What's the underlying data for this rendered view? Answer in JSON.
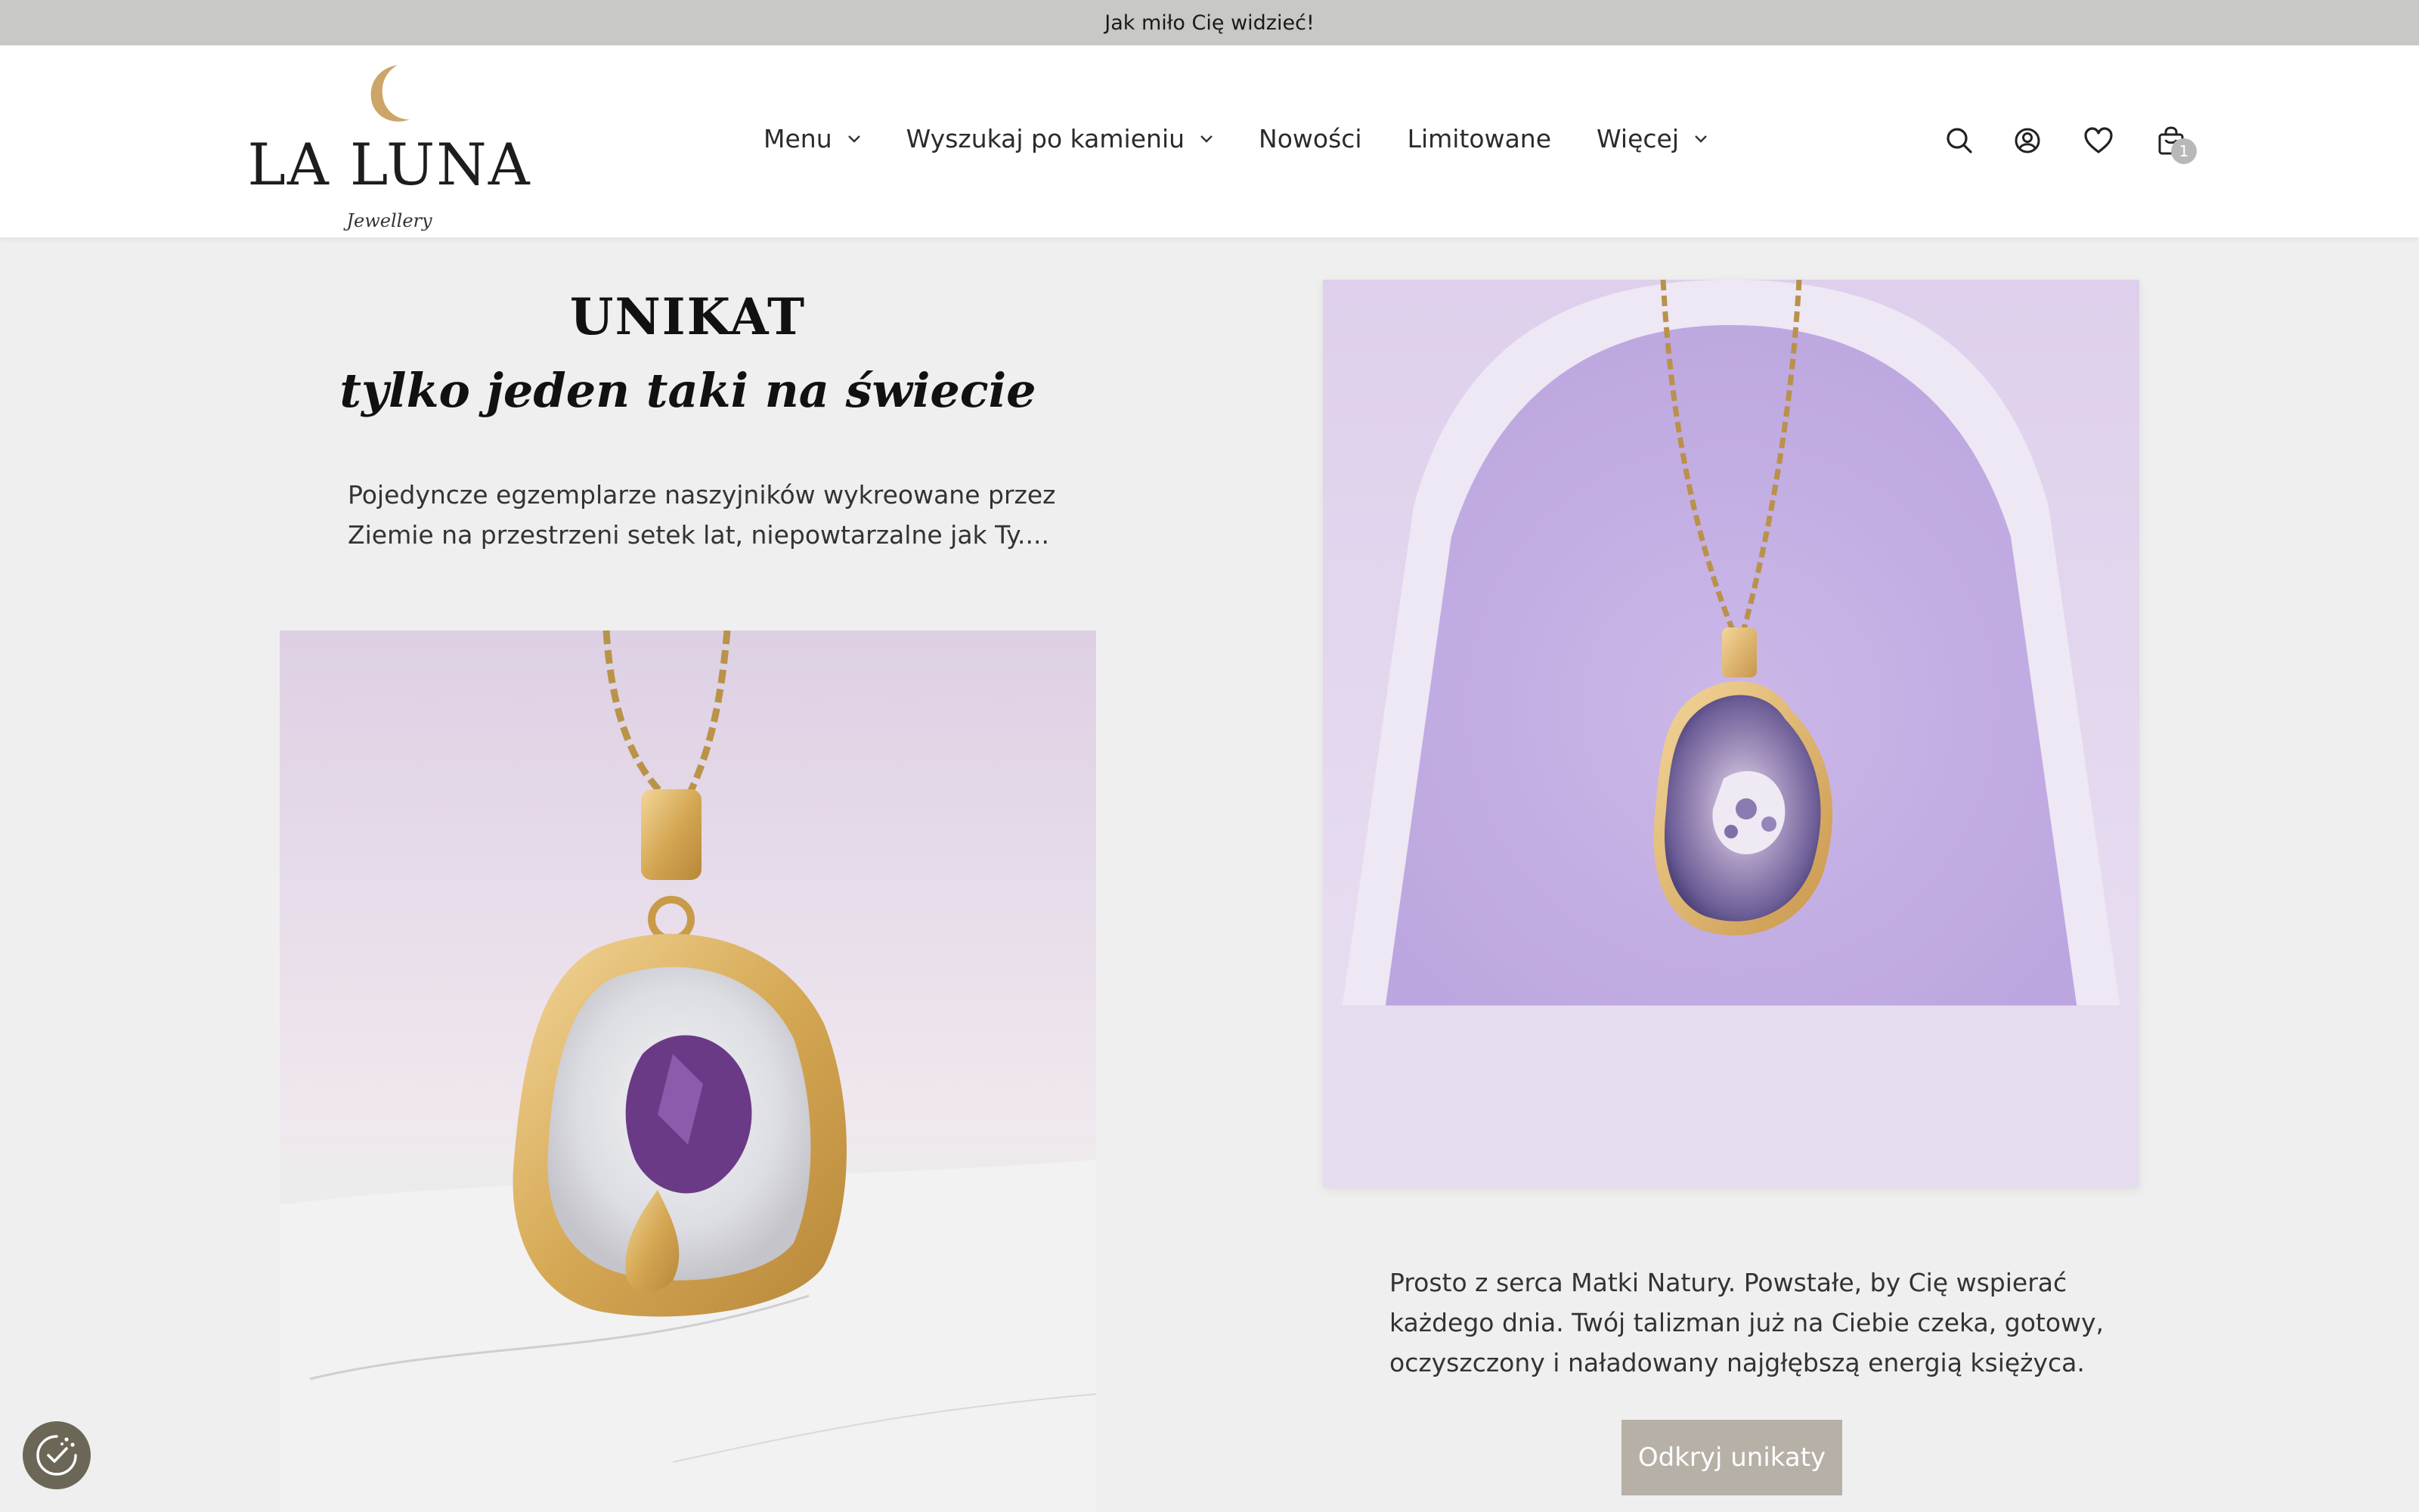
{
  "announcement": "Jak miło Cię widzieć!",
  "logo": {
    "brand": "LA LUNA",
    "sub": "Jewellery"
  },
  "nav": {
    "items": [
      {
        "label": "Menu",
        "dropdown": true
      },
      {
        "label": "Wyszukaj po kamieniu",
        "dropdown": true
      },
      {
        "label": "Nowości",
        "dropdown": false
      },
      {
        "label": "Limitowane",
        "dropdown": false
      },
      {
        "label": "Więcej",
        "dropdown": true
      }
    ]
  },
  "header_icons": [
    "search-icon",
    "account-icon",
    "heart-icon",
    "cart-icon"
  ],
  "cart": {
    "count": "1"
  },
  "promo": {
    "title": "UNIKAT",
    "subtitle": "tylko jeden taki na świecie",
    "description": "Pojedyncze egzemplarze naszyjników wykreowane przez Ziemie na przestrzeni setek lat, niepowtarzalne jak Ty...."
  },
  "feature": {
    "description": "Prosto z serca Matki Natury. Powstałe, by Cię wspierać każdego dnia. Twój talizman już na Ciebie czeka, gotowy, oczyszczony i naładowany najgłębszą energią księżyca.",
    "cta_label": "Odkryj unikaty"
  },
  "colors": {
    "announcement_bg": "#c8c8c5",
    "page_bg": "#efefef",
    "cta_bg": "#b6b0a6",
    "accent_gold": "#c9a35a",
    "cookie_bg": "#6b6656"
  }
}
